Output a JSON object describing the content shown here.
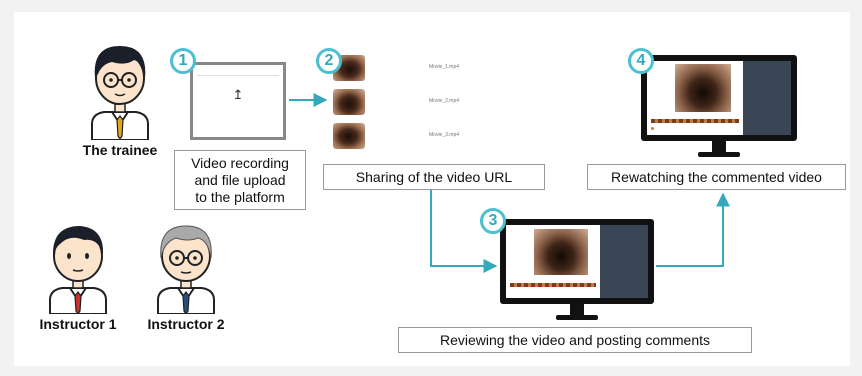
{
  "people": {
    "trainee": "The trainee",
    "instructor1": "Instructor 1",
    "instructor2": "Instructor 2"
  },
  "steps": [
    "1",
    "2",
    "3",
    "4"
  ],
  "captions": {
    "step1": "Video recording\nand file upload\nto the platform",
    "step2": "Sharing of the video URL",
    "step3": "Reviewing the video and posting comments",
    "step4": "Rewatching the commented video"
  },
  "files": [
    "Movie_1.mp4",
    "Movie_2.mp4",
    "Movie_3.mp4"
  ],
  "upload_glyph": "↥",
  "colors": {
    "accent": "#4bc0d0",
    "arrow": "#34a9bb",
    "frame": "#888888",
    "monitor": "#111111"
  },
  "icons": [
    "person-icon",
    "upload-icon",
    "video-thumbnail",
    "monitor-icon",
    "arrow-icon"
  ]
}
